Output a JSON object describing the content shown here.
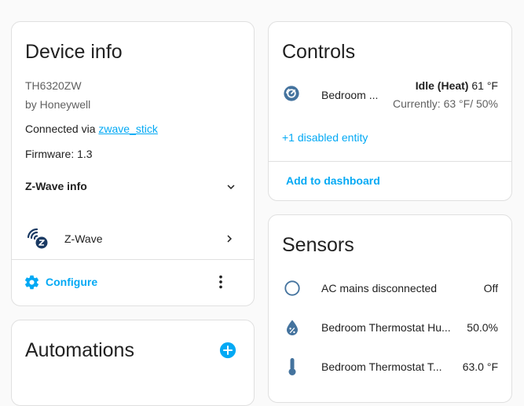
{
  "device_info": {
    "title": "Device info",
    "model": "TH6320ZW",
    "manufacturer": "by Honeywell",
    "connected_via_label": "Connected via",
    "connected_via_link": "zwave_stick",
    "firmware": "Firmware: 1.3",
    "zwave_info_label": "Z-Wave info",
    "integration_label": "Z-Wave",
    "configure_label": "Configure"
  },
  "automations": {
    "title": "Automations"
  },
  "controls": {
    "title": "Controls",
    "entity_name": "Bedroom ...",
    "state_bold": "Idle (Heat)",
    "state_temp": "61 °F",
    "currently": "Currently: 63 °F/ 50%",
    "disabled_entities": "+1 disabled entity",
    "add_to_dashboard": "Add to dashboard"
  },
  "sensors": {
    "title": "Sensors",
    "items": [
      {
        "name": "AC mains disconnected",
        "value": "Off",
        "icon": "circle-outline-icon"
      },
      {
        "name": "Bedroom Thermostat Hu...",
        "value": "50.0%",
        "icon": "water-percent-icon"
      },
      {
        "name": "Bedroom Thermostat T...",
        "value": "63.0 °F",
        "icon": "thermometer-icon"
      }
    ]
  },
  "colors": {
    "accent": "#03a9f4",
    "icon": "#44739e",
    "text": "#212121",
    "secondary_text": "#616161",
    "divider": "#e0e0e0"
  }
}
